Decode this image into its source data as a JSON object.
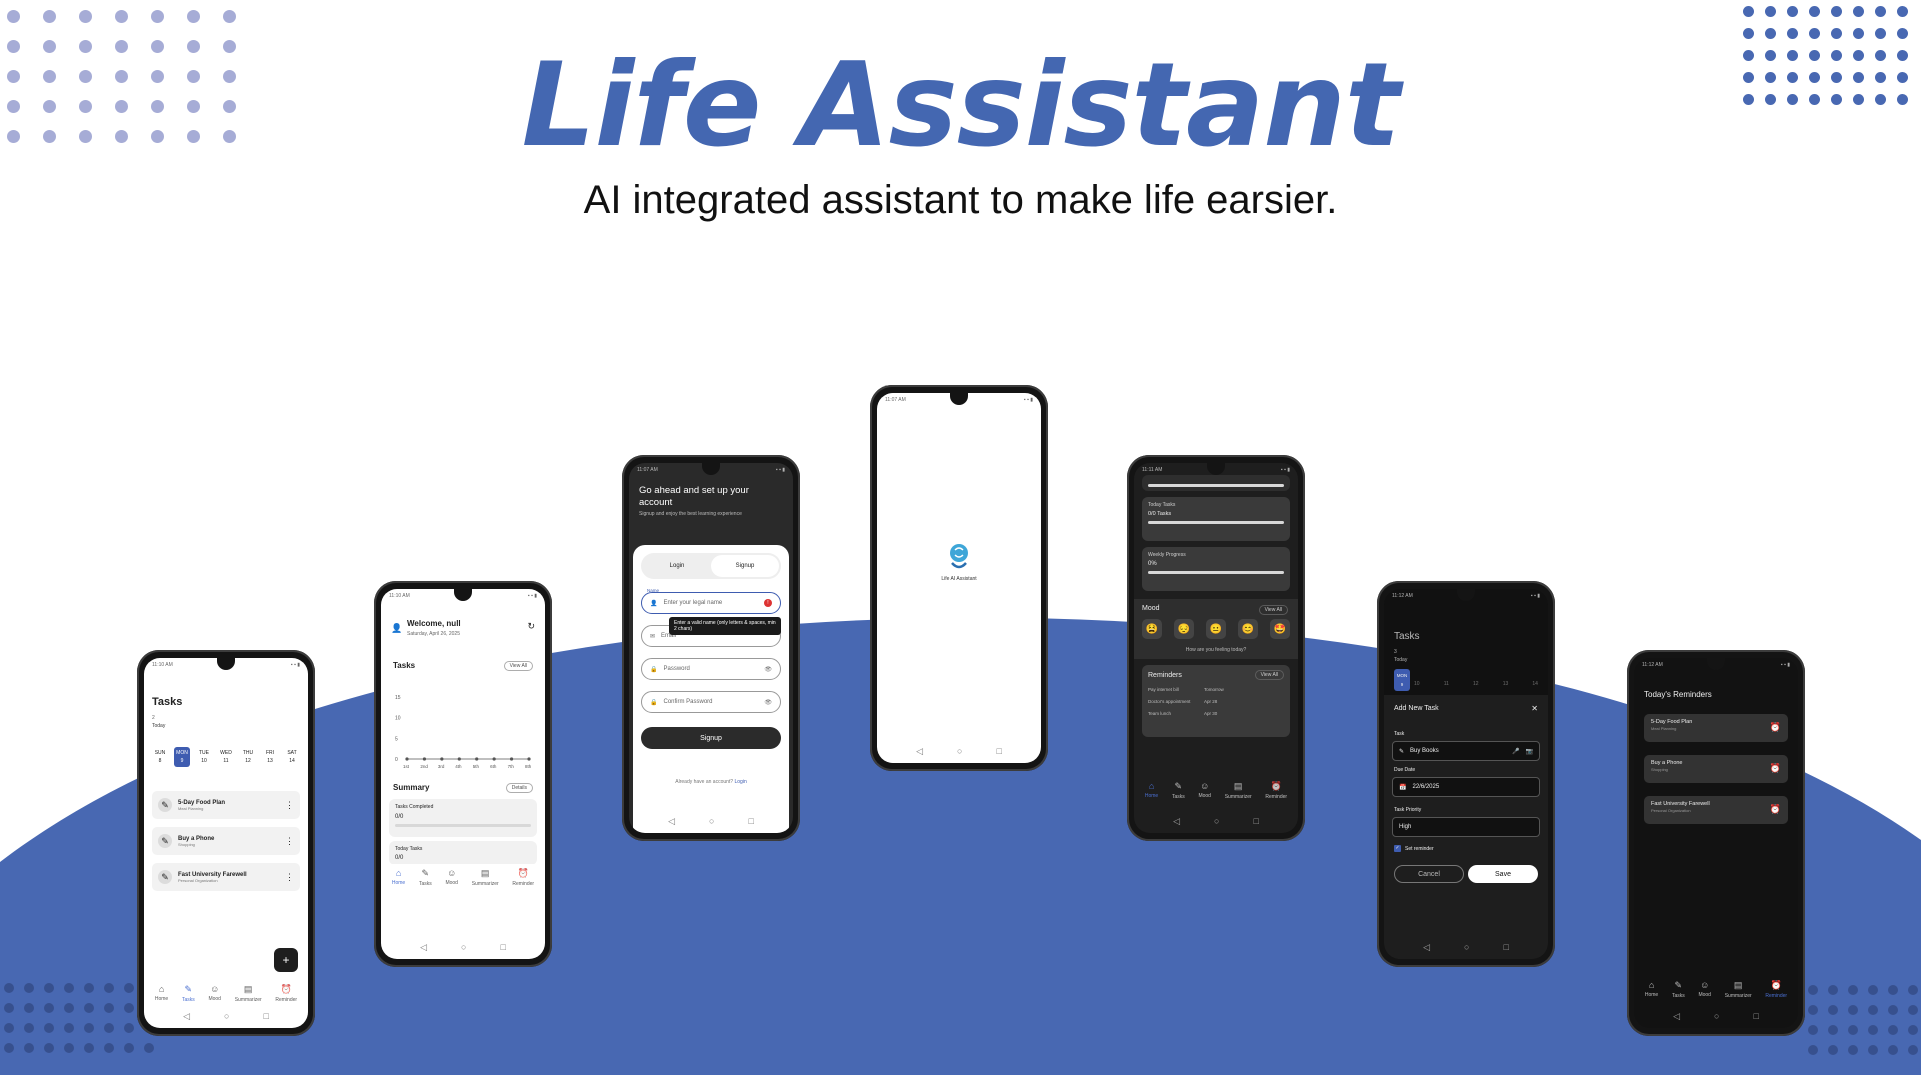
{
  "hero": {
    "title": "Life Assistant",
    "subtitle": "AI integrated assistant to make life earsier."
  },
  "colors": {
    "accent": "#4467b1",
    "wave": "#4868b2",
    "dots_light": "#a6acd6",
    "dark_bg": "#1e1e1e"
  },
  "system_nav": {
    "back": "◁",
    "home": "○",
    "recents": "□"
  },
  "bottom_nav": {
    "home": "Home",
    "tasks": "Tasks",
    "mood": "Mood",
    "summarizer": "Summarizer",
    "reminder": "Reminder",
    "icons": {
      "home": "⌂",
      "tasks": "✎",
      "mood": "☺",
      "summarizer": "▤",
      "reminder": "⏰"
    }
  },
  "phone1": {
    "status_time": "11:10 AM",
    "title": "Tasks",
    "count": "2",
    "today_label": "Today",
    "days": [
      {
        "name": "SUN",
        "num": "8"
      },
      {
        "name": "MON",
        "num": "9"
      },
      {
        "name": "TUE",
        "num": "10"
      },
      {
        "name": "WED",
        "num": "11"
      },
      {
        "name": "THU",
        "num": "12"
      },
      {
        "name": "FRI",
        "num": "13"
      },
      {
        "name": "SAT",
        "num": "14"
      }
    ],
    "tasks": [
      {
        "name": "5-Day Food Plan",
        "category": "Meal Planning"
      },
      {
        "name": "Buy a Phone",
        "category": "Shopping"
      },
      {
        "name": "Fast University Farewell",
        "category": "Personal Organization"
      }
    ],
    "fab": "+"
  },
  "phone2": {
    "status_time": "11:10 AM",
    "welcome": "Welcome, null",
    "date": "Saturday, April 26, 2025",
    "tasks_title": "Tasks",
    "view_all": "View All",
    "chart_y": [
      "15",
      "10",
      "5",
      "0"
    ],
    "chart_x": [
      "1st",
      "2nd",
      "3rd",
      "4th",
      "5th",
      "6th",
      "7th",
      "8th"
    ],
    "summary_title": "Summary",
    "details": "Details",
    "tasks_completed_label": "Tasks Completed",
    "tasks_completed_value": "0/0",
    "today_tasks_label": "Today Tasks",
    "today_tasks_value": "0/0"
  },
  "phone3": {
    "status_time": "11:07 AM",
    "heading": "Go ahead and set up your account",
    "sub": "Signup and enjoy the best learning experience",
    "tab_login": "Login",
    "tab_signup": "Signup",
    "name_label": "Name",
    "name_placeholder": "Enter your legal name",
    "email_placeholder": "Email",
    "tooltip": "Enter a valid name (only letters & spaces, min 2 chars)",
    "password_placeholder": "Password",
    "confirm_placeholder": "Confirm Password",
    "signup_button": "Signup",
    "already": "Already have an account?",
    "login_link": "Login"
  },
  "phone4": {
    "status_time": "11:07 AM",
    "logo_text": "Life AI Assistant"
  },
  "phone5": {
    "status_time": "11:11 AM",
    "today_tasks_label": "Today Tasks",
    "today_tasks_value": "0/0 Tasks",
    "weekly_label": "Weekly Progress",
    "weekly_value": "0%",
    "weekly_progress": 0,
    "mood_title": "Mood",
    "mood_view_all": "View All",
    "moods": [
      "😫",
      "😔",
      "😐",
      "😊",
      "🤩"
    ],
    "mood_prompt": "How are you feeling today?",
    "reminders_title": "Reminders",
    "reminders_view_all": "View All",
    "reminders": [
      {
        "name": "Pay internet bill",
        "when": "Tomorrow"
      },
      {
        "name": "Doctor's appointment",
        "when": "Apr 28"
      },
      {
        "name": "Team lunch",
        "when": "Apr 30"
      }
    ]
  },
  "phone6": {
    "status_time": "11:12 AM",
    "title": "Tasks",
    "count": "3",
    "today_label": "Today",
    "sel_day": "MON",
    "sel_num": "9",
    "other_nums": [
      "8",
      "10",
      "11",
      "12",
      "13",
      "14"
    ],
    "modal_title": "Add New Task",
    "close": "✕",
    "task_label": "Task",
    "task_value": "Buy Books",
    "due_label": "Due Date",
    "due_value": "22/6/2025",
    "priority_label": "Task Priority",
    "priority_value": "High",
    "reminder_label": "Set reminder",
    "cancel": "Cancel",
    "save": "Save"
  },
  "phone7": {
    "status_time": "11:12 AM",
    "title": "Today's Reminders",
    "reminders": [
      {
        "name": "5-Day Food Plan",
        "category": "Meal Planning"
      },
      {
        "name": "Buy a Phone",
        "category": "Shopping"
      },
      {
        "name": "Fast University Farewell",
        "category": "Personal Organization"
      }
    ]
  }
}
